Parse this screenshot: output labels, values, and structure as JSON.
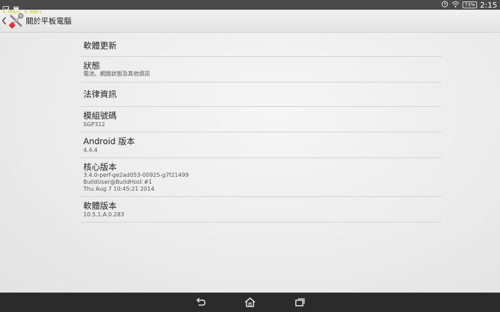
{
  "status_bar": {
    "left_icons": [
      "image-icon",
      "photo-icon"
    ],
    "right_icons": [
      "alarm-icon",
      "wifi-icon"
    ],
    "battery": "73%",
    "time": "2:15"
  },
  "action_bar": {
    "net_speed_down": "0.0KB/s",
    "net_speed_up": "0.0KB/s",
    "title": "關於平板電腦"
  },
  "settings": {
    "items": [
      {
        "title": "軟體更新",
        "subtitle": []
      },
      {
        "title": "狀態",
        "subtitle": [
          "電池、網路狀態及其他資訊"
        ]
      },
      {
        "title": "法律資訊",
        "subtitle": []
      },
      {
        "title": "模組號碼",
        "subtitle": [
          "SGP312"
        ]
      },
      {
        "title": "Android 版本",
        "subtitle": [
          "4.4.4"
        ]
      },
      {
        "title": "核心版本",
        "subtitle": [
          "3.4.0-perf-ge2ad053-00925-g7f21499",
          "BuildUser@BuildHost #1",
          "Thu Aug 7 10:45:21 2014"
        ]
      },
      {
        "title": "軟體版本",
        "subtitle": [
          "10.5.1.A.0.283"
        ]
      }
    ]
  },
  "nav_bar": {
    "buttons": [
      "back-icon",
      "home-icon",
      "recents-icon"
    ]
  },
  "colors": {
    "status_bar": "#4a4a4a",
    "nav_bar": "#2b2b2b",
    "net_speed": "#c9c900"
  }
}
